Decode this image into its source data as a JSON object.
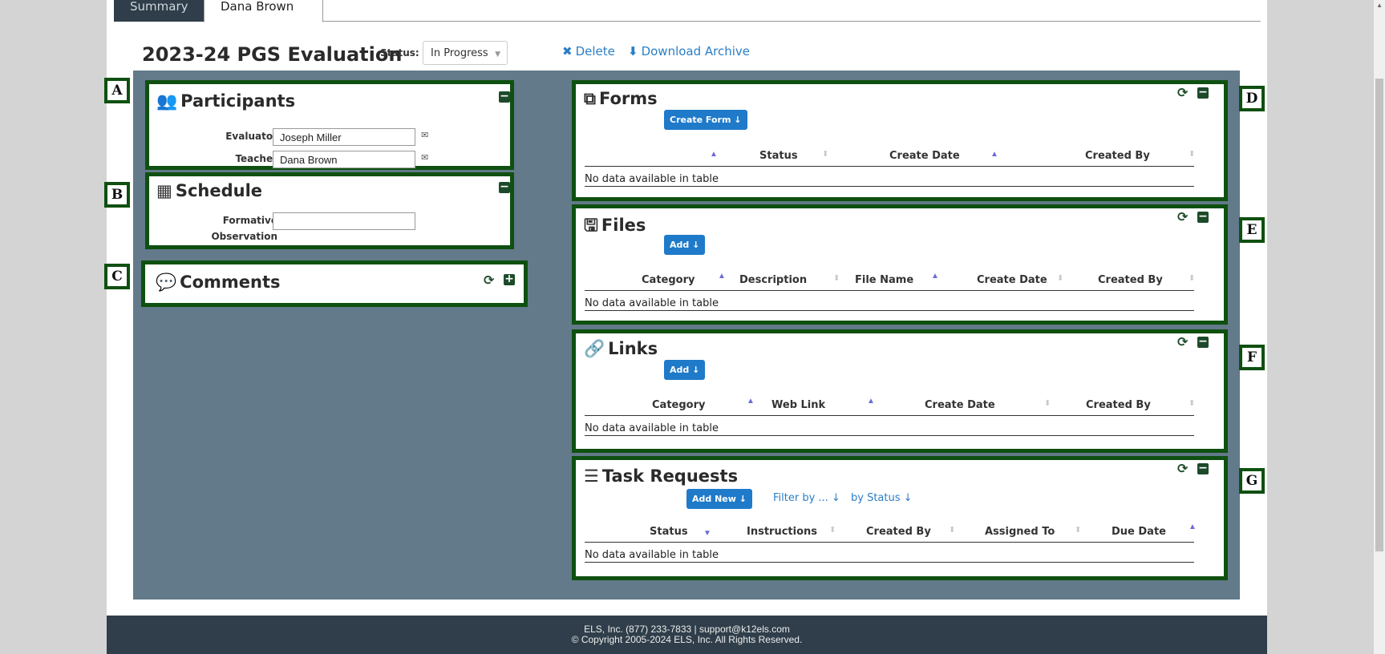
{
  "tabs": {
    "summary": "Summary",
    "person": "Dana Brown"
  },
  "evaluation": {
    "title": "2023-24 PGS Evaluation",
    "status_label": "Status:",
    "status_value": "In Progress",
    "delete_label": "Delete",
    "download_label": "Download Archive"
  },
  "participants": {
    "title": "Participants",
    "evaluator_label": "Evaluator",
    "evaluator_value": "Joseph Miller",
    "teacher_label": "Teacher",
    "teacher_value": "Dana Brown"
  },
  "schedule": {
    "title": "Schedule",
    "observation_label_1": "Formative",
    "observation_label_2": "Observation",
    "observation_value": ""
  },
  "comments": {
    "title": "Comments"
  },
  "forms": {
    "title": "Forms",
    "create_button": "Create Form ↓",
    "columns": [
      "Status",
      "Create Date",
      "Created By"
    ],
    "empty": "No data available in table"
  },
  "files": {
    "title": "Files",
    "add_button": "Add ↓",
    "columns": [
      "Category",
      "Description",
      "File Name",
      "Create Date",
      "Created By"
    ],
    "empty": "No data available in table"
  },
  "links": {
    "title": "Links",
    "add_button": "Add ↓",
    "columns": [
      "Category",
      "Web Link",
      "Create Date",
      "Created By"
    ],
    "empty": "No data available in table"
  },
  "tasks": {
    "title": "Task Requests",
    "add_button": "Add New ↓",
    "filter_label": "Filter by ... ↓",
    "by_status_label": "by Status ↓",
    "columns": [
      "Status",
      "Instructions",
      "Created By",
      "Assigned To",
      "Due Date"
    ],
    "empty": "No data available in table"
  },
  "markers": [
    "A",
    "B",
    "C",
    "D",
    "E",
    "F",
    "G"
  ],
  "footer": {
    "line1": "ELS, Inc. (877) 233-7833 | support@k12els.com",
    "line2": "© Copyright 2005-2024 ELS, Inc. All Rights Reserved."
  }
}
